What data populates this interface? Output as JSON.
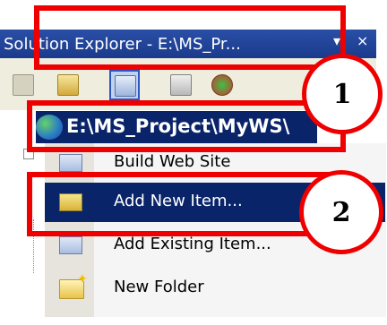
{
  "solution_explorer": {
    "title": "Solution Explorer - E:\\MS_Pr...",
    "pin_glyph": "▾",
    "close_glyph": "×",
    "project_path": "E:\\MS_Project\\MyWS\\"
  },
  "context_menu": {
    "items": [
      {
        "label": "Build Web Site",
        "icon": "build-web-site-icon"
      },
      {
        "label": "Add New Item...",
        "icon": "add-new-item-icon",
        "highlighted": true
      },
      {
        "label": "Add Existing Item...",
        "icon": "add-existing-item-icon"
      },
      {
        "label": "New Folder",
        "icon": "new-folder-icon"
      }
    ]
  },
  "callouts": {
    "first": "1",
    "second": "2"
  },
  "colors": {
    "annotation_red": "#ee0000",
    "selection_navy": "#0a246a",
    "title_blue": "#1a3a8c"
  }
}
